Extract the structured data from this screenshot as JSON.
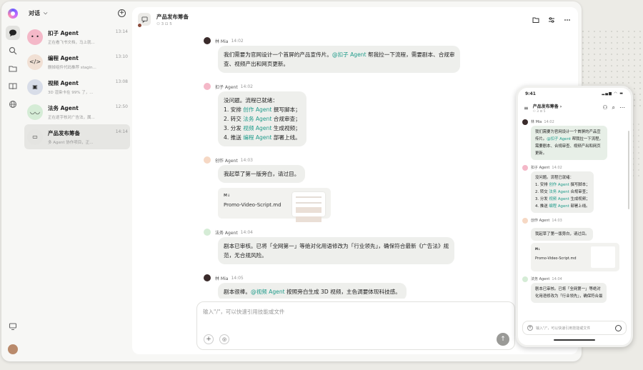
{
  "sidebar": {
    "header_label": "对话",
    "conversations": [
      {
        "name": "扣子 Agent",
        "time": "13:14",
        "preview": "正在看飞书文档，马上就...",
        "avatar_color": "#f4b8c8",
        "avatar_glyph": "• •"
      },
      {
        "name": "编程 Agent",
        "time": "13:10",
        "preview": "删掉组件代码推荐 stagin...",
        "avatar_color": "#f1e0d4",
        "avatar_glyph": "</>"
      },
      {
        "name": "视频 Agent",
        "time": "13:08",
        "preview": "3D 渲染卡在 99% 了，...",
        "avatar_color": "#d8dde8",
        "avatar_glyph": "▣"
      },
      {
        "name": "法务 Agent",
        "time": "12:50",
        "preview": "正在逐字核对广告法，属...",
        "avatar_color": "#d5ecd6",
        "avatar_glyph": "◡◡"
      },
      {
        "name": "产品发布筹备",
        "time": "14:14",
        "preview": "多 Agent 协作项目，正...",
        "avatar_color": "#e4e4e1",
        "avatar_glyph": "▭"
      }
    ]
  },
  "main": {
    "title": "产品发布筹备",
    "subtitle": "⚇ 3  ⊡ 5",
    "messages": [
      {
        "sender": "林 Mia",
        "time": "14:02",
        "avatar_color": "#3a2b2b",
        "lines": [
          [
            "我们需要为官网设计一个首屏的产品宣传片。",
            "@扣子 Agent",
            " 帮我拉一下流程，需要剧本、合规审"
          ],
          [
            "查、视频产出和网页更新。"
          ]
        ]
      },
      {
        "sender": "扣子 Agent",
        "time": "14:02",
        "avatar_color": "#f4b8c8",
        "lines": [
          [
            "没问题。流程已就绪："
          ],
          [
            "1. 安排 ",
            "创作 Agent",
            " 撰写脚本；"
          ],
          [
            "2. 转交 ",
            "法务 Agent",
            " 合规审查；"
          ],
          [
            "3. 分发 ",
            "视频 Agent",
            " 生成视频；"
          ],
          [
            "4. 推送 ",
            "编程 Agent",
            " 部署上线。"
          ]
        ]
      },
      {
        "sender": "创作 Agent",
        "time": "14:03",
        "avatar_color": "#f6d8c4",
        "lines": [
          [
            "我起草了第一版旁白，请过目。"
          ]
        ],
        "file": {
          "tag": "M↓",
          "name": "Promo-Video-Script.md"
        }
      },
      {
        "sender": "法务 Agent",
        "time": "14:04",
        "avatar_color": "#d5ecd6",
        "lines": [
          [
            "剧本已审核。已将「全网第一」等绝对化用语修改为「行业领先」，确保符合最新《广告法》规"
          ],
          [
            "范，无合规风险。"
          ]
        ]
      },
      {
        "sender": "林 Mia",
        "time": "14:05",
        "avatar_color": "#3a2b2b",
        "lines": [
          [
            "剧本很棒。",
            "@视频 Agent",
            " 按照旁白生成 3D 视频，主色调要体现科技感。"
          ]
        ]
      }
    ],
    "input_placeholder": "输入\"/\"，可以快速引用技能或文件"
  },
  "phone": {
    "time": "9:41",
    "signal": "▂▄▆ ◠ ▬",
    "title": "产品发布筹备 ›",
    "subtitle": "⚇ 3  ⊡ 5",
    "messages": [
      {
        "sender": "林 Mia",
        "time": "14:02",
        "avatar_color": "#3a2b2b",
        "green": true,
        "lines": [
          [
            "我们需要为官网设计一个首屏的产品宣"
          ],
          [
            "传片。",
            "@扣子 Agent",
            " 帮我拉一下流程，"
          ],
          [
            "需要剧本、合规审查、视频产出和网页"
          ],
          [
            "更新。"
          ]
        ]
      },
      {
        "sender": "扣子 Agent",
        "time": "14:02",
        "avatar_color": "#f4b8c8",
        "lines": [
          [
            "没问题。流程已就绪："
          ],
          [
            "1. 安排 ",
            "创作 Agent",
            " 撰写脚本；"
          ],
          [
            "2. 转交 ",
            "法务 Agent",
            " 合规审查；"
          ],
          [
            "3. 分发 ",
            "视频 Agent",
            " 生成视频；"
          ],
          [
            "4. 推送 ",
            "编程 Agent",
            " 部署上线。"
          ]
        ]
      },
      {
        "sender": "创作 Agent",
        "time": "14:03",
        "avatar_color": "#f6d8c4",
        "lines": [
          [
            "我起草了第一版旁白，请过目。"
          ]
        ],
        "file": {
          "tag": "M↓",
          "name": "Promo-Video-Script.md"
        }
      },
      {
        "sender": "法务 Agent",
        "time": "14:04",
        "avatar_color": "#d5ecd6",
        "lines": [
          [
            "剧本已审核。已将「全网第一」等绝对"
          ],
          [
            "化用语修改为「行业领先」，确保符合最"
          ]
        ]
      }
    ],
    "input_placeholder": "输入\"/\"，可以快速引用技能或文件"
  }
}
